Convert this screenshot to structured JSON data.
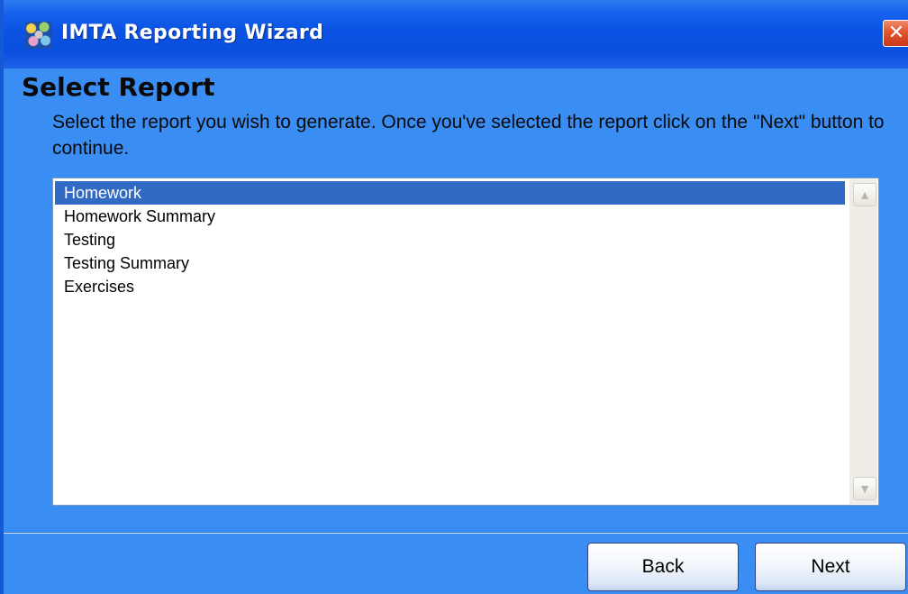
{
  "window": {
    "title": "IMTA Reporting Wizard",
    "close_glyph": "✕"
  },
  "page": {
    "heading": "Select Report",
    "description": "Select the report you wish to generate. Once you've selected the report click on the \"Next\" button to continue."
  },
  "report_list": {
    "selected_index": 0,
    "items": [
      {
        "label": "Homework"
      },
      {
        "label": "Homework Summary"
      },
      {
        "label": "Testing"
      },
      {
        "label": "Testing Summary"
      },
      {
        "label": "Exercises"
      }
    ],
    "scroll_up_glyph": "▲",
    "scroll_down_glyph": "▼"
  },
  "buttons": {
    "back_label": "Back",
    "next_label": "Next"
  },
  "colors": {
    "titlebar": "#0b53e4",
    "window_body": "#3a8ef3",
    "selection": "#316ac5",
    "close_button": "#e2542e"
  }
}
